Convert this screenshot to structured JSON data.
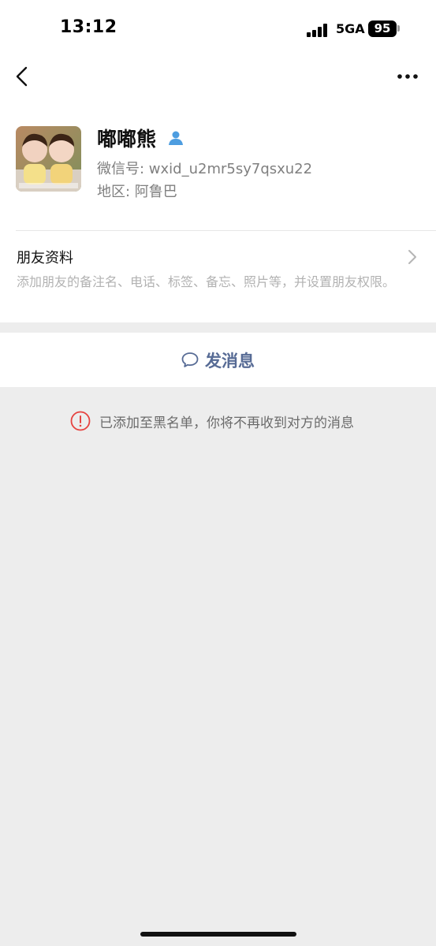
{
  "status_bar": {
    "time": "13:12",
    "network": "5GA",
    "battery": "95"
  },
  "nav": {
    "back_icon": "chevron-left-icon",
    "more_icon": "more-dots-icon"
  },
  "profile": {
    "avatar_icon": "avatar",
    "name": "嘟嘟熊",
    "name_badge_icon": "person-icon",
    "wechat_id": "微信号: wxid_u2mr5sy7qsxu22",
    "region": "地区: 阿鲁巴"
  },
  "friend_info": {
    "title": "朋友资料",
    "description": "添加朋友的备注名、电话、标签、备忘、照片等，并设置朋友权限。"
  },
  "actions": {
    "send_message_label": "发消息"
  },
  "notice": {
    "text": "已添加至黑名单，你将不再收到对方的消息"
  },
  "colors": {
    "accent": "#576b95",
    "warning": "#e64340",
    "background": "#ededed"
  }
}
